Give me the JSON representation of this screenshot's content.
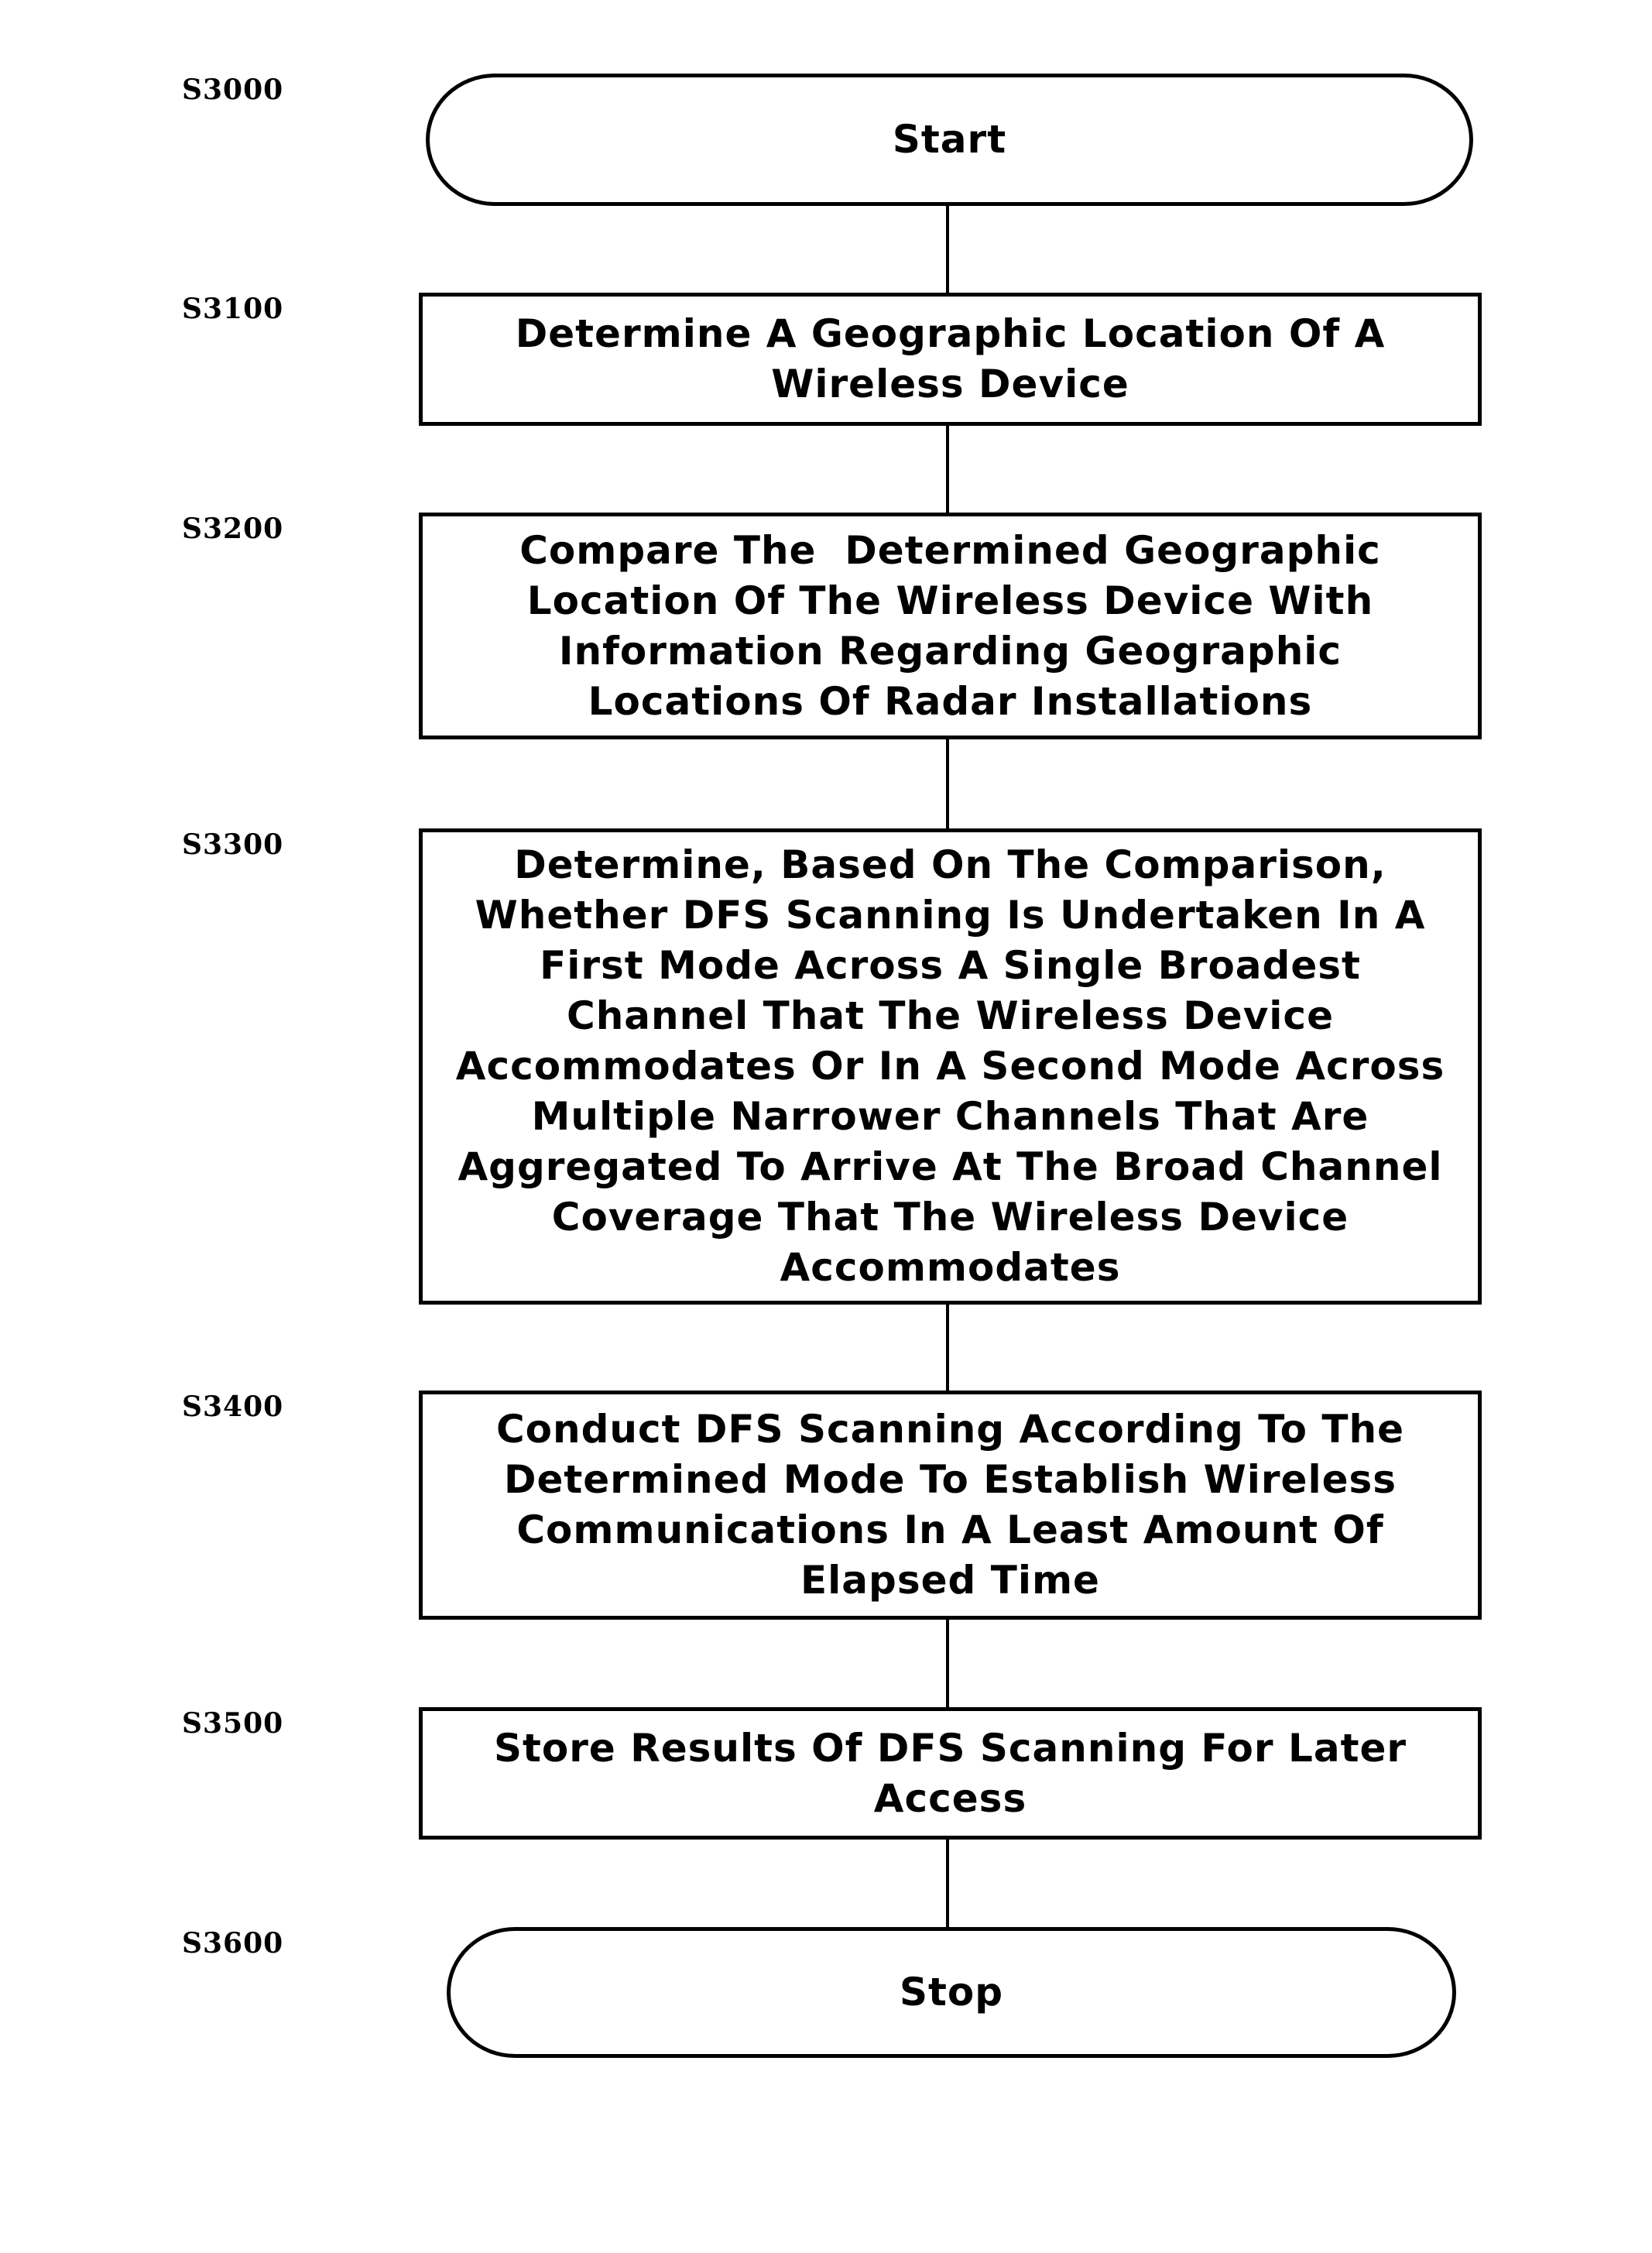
{
  "flowchart": {
    "steps": [
      {
        "id": "S3000",
        "type": "terminal",
        "text": "Start"
      },
      {
        "id": "S3100",
        "type": "process",
        "text": "Determine A Geographic Location Of A\nWireless Device"
      },
      {
        "id": "S3200",
        "type": "process",
        "text": "Compare The  Determined Geographic\nLocation Of The Wireless Device With\nInformation Regarding Geographic\nLocations Of Radar Installations"
      },
      {
        "id": "S3300",
        "type": "process",
        "text": "Determine, Based On The Comparison,\nWhether DFS Scanning Is Undertaken In A\nFirst Mode Across A Single Broadest\nChannel That The Wireless Device\nAccommodates Or In A Second Mode Across\nMultiple Narrower Channels That Are\nAggregated To Arrive At The Broad Channel\nCoverage That The Wireless Device\nAccommodates"
      },
      {
        "id": "S3400",
        "type": "process",
        "text": "Conduct DFS Scanning According To The\nDetermined Mode To Establish Wireless\nCommunications In A Least Amount Of\nElapsed Time"
      },
      {
        "id": "S3500",
        "type": "process",
        "text": "Store Results Of DFS Scanning For Later\nAccess"
      },
      {
        "id": "S3600",
        "type": "terminal",
        "text": "Stop"
      }
    ]
  }
}
